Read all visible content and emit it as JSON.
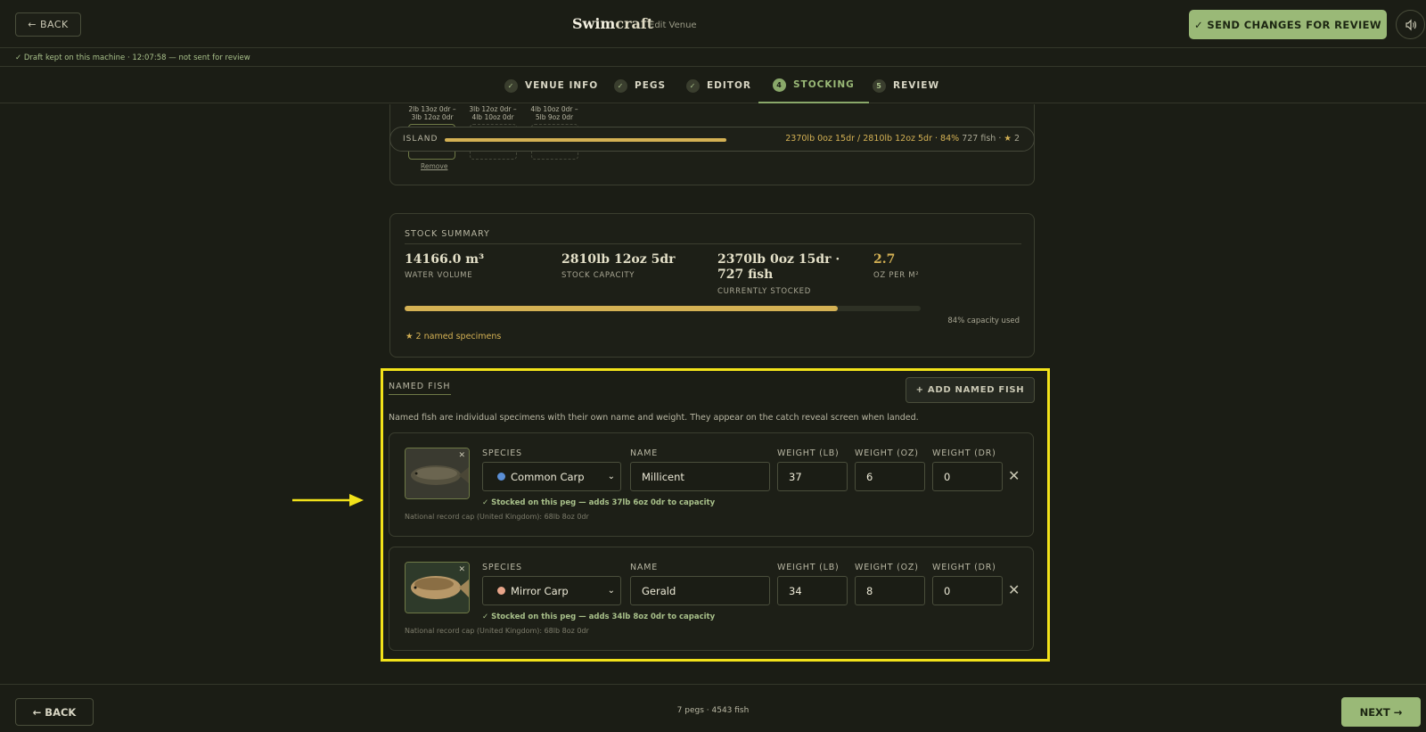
{
  "header": {
    "back_label": "← BACK",
    "brand_swim": "Swim",
    "brand_craft": "craft",
    "subtitle": "Edit Venue",
    "send_label": "✓ SEND CHANGES FOR REVIEW",
    "sound_icon": "speaker-icon"
  },
  "draft_status": "✓ Draft kept on this machine · 12:07:58 — not sent for review",
  "steps": [
    {
      "marker": "✓",
      "label": "VENUE INFO"
    },
    {
      "marker": "✓",
      "label": "PEGS"
    },
    {
      "marker": "✓",
      "label": "EDITOR"
    },
    {
      "marker": "4",
      "label": "STOCKING"
    },
    {
      "marker": "5",
      "label": "REVIEW"
    }
  ],
  "peg_slots": {
    "labels": [
      "2lb 13oz 0dr – 3lb 12oz 0dr",
      "3lb 12oz 0dr – 4lb 10oz 0dr",
      "4lb 10oz 0dr – 5lb 9oz 0dr"
    ],
    "remove": "Remove"
  },
  "island": {
    "label": "ISLAND",
    "fill_fraction": 0.84,
    "stats": "2370lb 0oz 15dr / 2810lb 12oz 5dr · 84%",
    "fish": "727 fish ·",
    "named": "2"
  },
  "stock_summary": {
    "title": "STOCK SUMMARY",
    "water_volume": "14166.0 m³",
    "water_volume_label": "WATER VOLUME",
    "capacity": "2810lb 12oz 5dr",
    "capacity_label": "STOCK CAPACITY",
    "stocked": "2370lb 0oz 15dr · 727 fish",
    "stocked_label": "CURRENTLY STOCKED",
    "oz_per_m2": "2.7",
    "oz_per_m2_label": "OZ PER M²",
    "capacity_fraction": 0.84,
    "capacity_used": "84% capacity used",
    "named_specimens": "2 named specimens"
  },
  "named_fish": {
    "title": "NAMED FISH",
    "add_label": "+ ADD NAMED FISH",
    "description": "Named fish are individual specimens with their own name and weight. They appear on the catch reveal screen when landed.",
    "labels": {
      "species": "SPECIES",
      "name": "NAME",
      "lb": "WEIGHT (LB)",
      "oz": "WEIGHT (OZ)",
      "dr": "WEIGHT (DR)"
    },
    "fish": [
      {
        "species": "Common Carp",
        "species_color": "#5b8fd6",
        "name": "Millicent",
        "lb": "37",
        "oz": "6",
        "dr": "0",
        "note": "✓ Stocked on this peg — adds 37lb 6oz 0dr to capacity",
        "record": "National record cap (United Kingdom): 68lb 8oz 0dr"
      },
      {
        "species": "Mirror Carp",
        "species_color": "#e8a58a",
        "name": "Gerald",
        "lb": "34",
        "oz": "8",
        "dr": "0",
        "note": "✓ Stocked on this peg — adds 34lb 8oz 0dr to capacity",
        "record": "National record cap (United Kingdom): 68lb 8oz 0dr"
      }
    ]
  },
  "footer": {
    "back_label": "← BACK",
    "stats": "7 pegs · 4543 fish",
    "next_label": "NEXT →"
  },
  "colors": {
    "accent": "#9ab977",
    "gold": "#d4b154",
    "highlight": "#f2e21a",
    "background": "#1b1d15"
  }
}
